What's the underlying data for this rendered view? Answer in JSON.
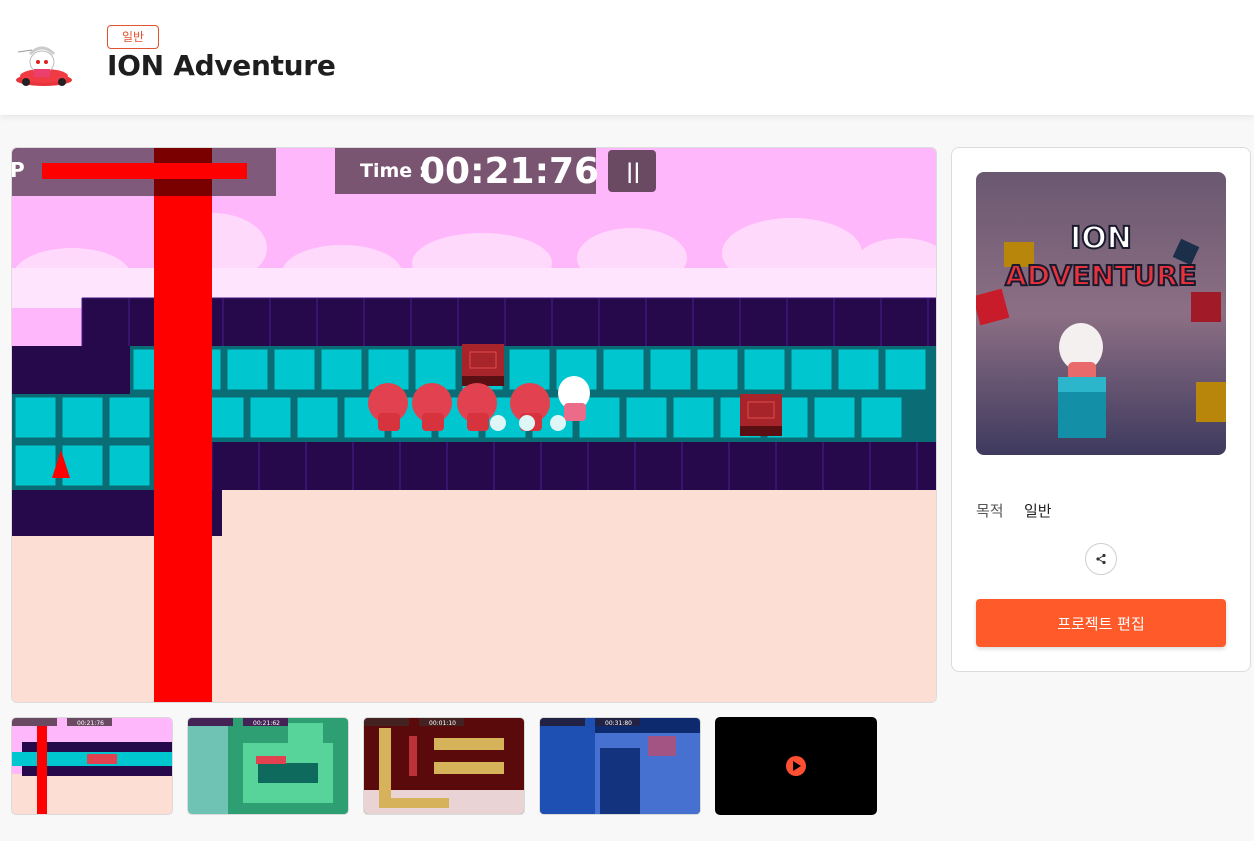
{
  "header": {
    "category_badge": "일반",
    "title": "ION Adventure",
    "avatar_icon": "character-avatar-icon"
  },
  "game": {
    "hud_hp_label": "P",
    "timer_label": "Time :",
    "timer_value": "00:21:76",
    "pause_label": "||",
    "hud_hp_fill": 0.85,
    "colors": {
      "sky": "#ffb7fb",
      "floor": "#fdded4",
      "dark_block": "#25094a",
      "cyan_block": "#00c6cf",
      "hazard": "#ff0000"
    }
  },
  "thumbnails": [
    {
      "timer": "00:21:76",
      "theme": "pink-cyan"
    },
    {
      "timer": "00:21:62",
      "theme": "green"
    },
    {
      "timer": "00:01:10",
      "theme": "yellow-maroon"
    },
    {
      "timer": "00:31:80",
      "theme": "blue"
    },
    {
      "theme": "video",
      "icon": "play-icon"
    }
  ],
  "panel": {
    "cover_title_line1": "ION",
    "cover_title_line2": "ADVENTURE",
    "purpose_label": "목적",
    "purpose_value": "일반",
    "share_icon": "share-icon",
    "edit_button": "프로젝트 편집"
  }
}
